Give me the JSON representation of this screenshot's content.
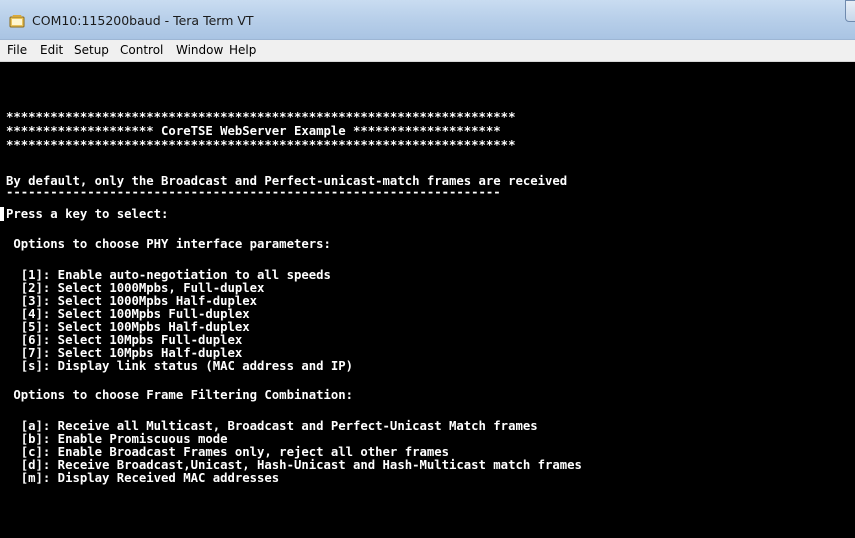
{
  "window": {
    "title": "COM10:115200baud - Tera Term VT",
    "icon": "teraterm-app-icon"
  },
  "menubar": {
    "items": [
      "File",
      "Edit",
      "Setup",
      "Control",
      "Window",
      "Help"
    ]
  },
  "terminal": {
    "banner": [
      "*********************************************************************",
      "******************** CoreTSE WebServer Example ********************",
      "*********************************************************************"
    ],
    "default_info": "By default, only the Broadcast and Perfect-unicast-match frames are received",
    "separator": "-------------------------------------------------------------------",
    "prompt": "Press a key to select:",
    "phy_heading": " Options to choose PHY interface parameters:",
    "phy_options": [
      "  [1]: Enable auto-negotiation to all speeds",
      "  [2]: Select 1000Mpbs, Full-duplex",
      "  [3]: Select 1000Mpbs Half-duplex",
      "  [4]: Select 100Mpbs Full-duplex",
      "  [5]: Select 100Mpbs Half-duplex",
      "  [6]: Select 10Mpbs Full-duplex",
      "  [7]: Select 10Mpbs Half-duplex",
      "  [s]: Display link status (MAC address and IP)"
    ],
    "filter_heading": " Options to choose Frame Filtering Combination:",
    "filter_options": [
      "  [a]: Receive all Multicast, Broadcast and Perfect-Unicast Match frames",
      "  [b]: Enable Promiscuous mode",
      "  [c]: Enable Broadcast Frames only, reject all other frames",
      "  [d]: Receive Broadcast,Unicast, Hash-Unicast and Hash-Multicast match frames",
      "  [m]: Display Received MAC addresses"
    ]
  },
  "colors": {
    "terminal_bg": "#000000",
    "terminal_fg": "#ffffff",
    "titlebar": "#b9d0ea"
  }
}
